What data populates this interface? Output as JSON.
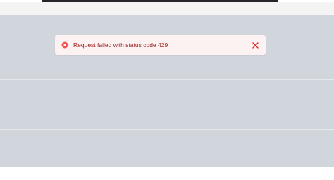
{
  "alert": {
    "message": "Request failed with status code 429",
    "icon": "x-circle-icon",
    "close_icon": "close-icon",
    "color": "#9b1c1c",
    "background": "#fdf2f2",
    "icon_color": "#f05252"
  },
  "overlay": {
    "color": "#d1d5dc"
  }
}
